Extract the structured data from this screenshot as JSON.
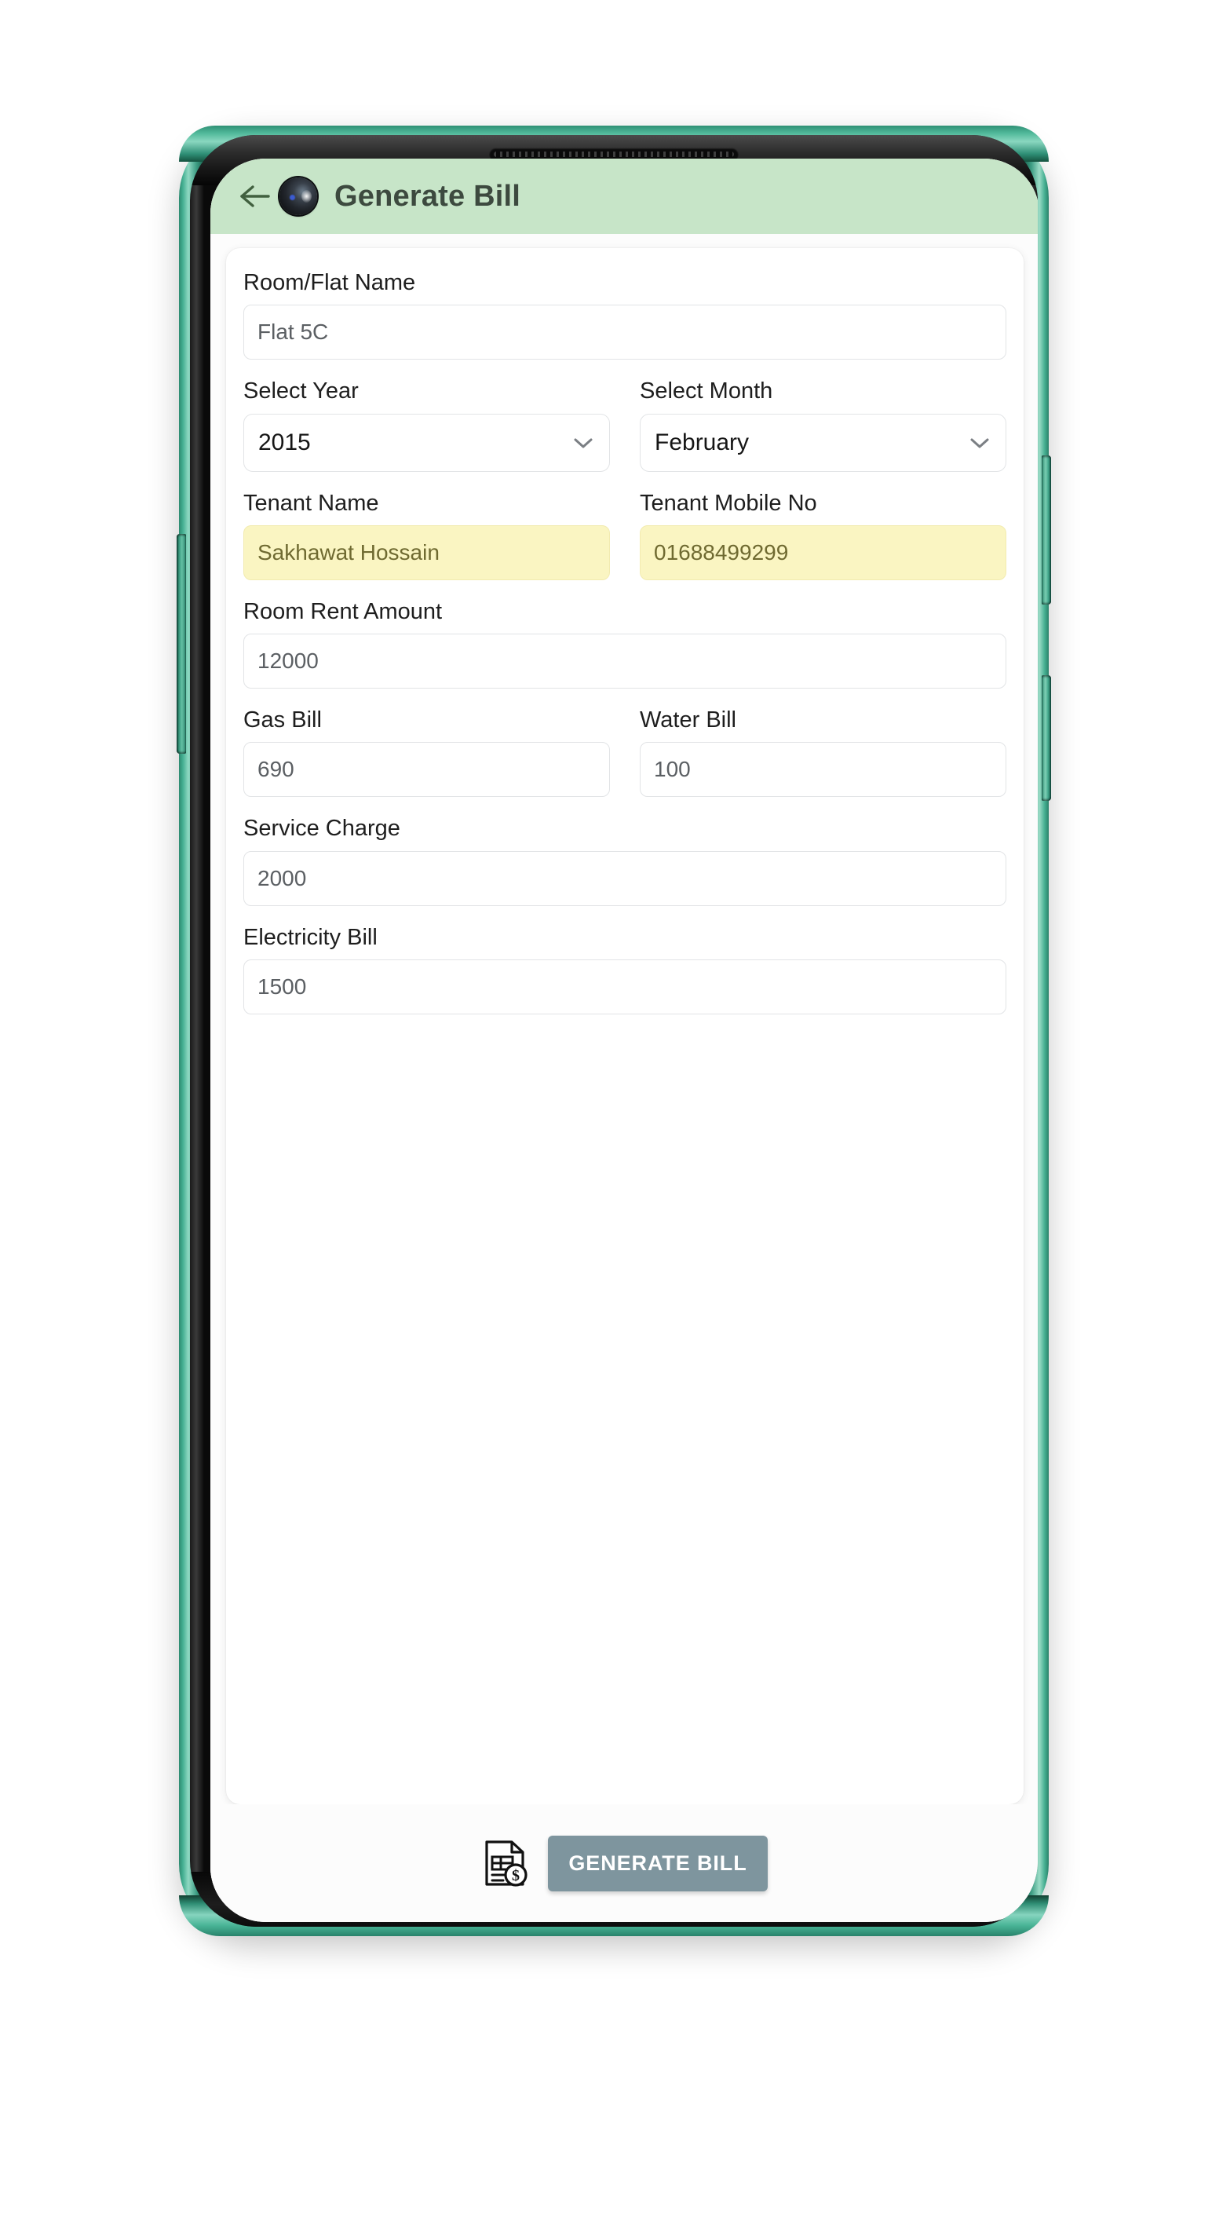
{
  "appbar": {
    "title": "Generate Bill",
    "back_icon": "arrow-left-icon",
    "header_color": "#c7e5c8",
    "title_color": "#3d4a3f"
  },
  "form": {
    "room_flat": {
      "label": "Room/Flat Name",
      "value": "Flat 5C"
    },
    "year": {
      "label": "Select Year",
      "value": "2015",
      "icon": "chevron-down-icon"
    },
    "month": {
      "label": "Select Month",
      "value": "February",
      "icon": "chevron-down-icon"
    },
    "tenant_name": {
      "label": "Tenant Name",
      "value": "Sakhawat Hossain",
      "autofill_bg": "#faf5c2"
    },
    "tenant_mobile": {
      "label": "Tenant Mobile No",
      "value": "01688499299",
      "autofill_bg": "#faf5c2"
    },
    "room_rent": {
      "label": "Room Rent Amount",
      "value": "12000"
    },
    "gas_bill": {
      "label": "Gas Bill",
      "value": "690"
    },
    "water_bill": {
      "label": "Water Bill",
      "value": "100"
    },
    "service_charge": {
      "label": "Service Charge",
      "value": "2000"
    },
    "electricity_bill": {
      "label": "Electricity Bill",
      "value": "1500"
    }
  },
  "footer": {
    "icon": "invoice-dollar-icon",
    "generate_label": "GENERATE BILL",
    "button_color": "#7e959e"
  },
  "device": {
    "frame_color": "#2e8f74",
    "speaker": "earpiece-speaker-grille",
    "camera": "front-camera-punch-hole",
    "buttons": [
      "volume-rocker",
      "power-button",
      "left-side-button"
    ]
  }
}
